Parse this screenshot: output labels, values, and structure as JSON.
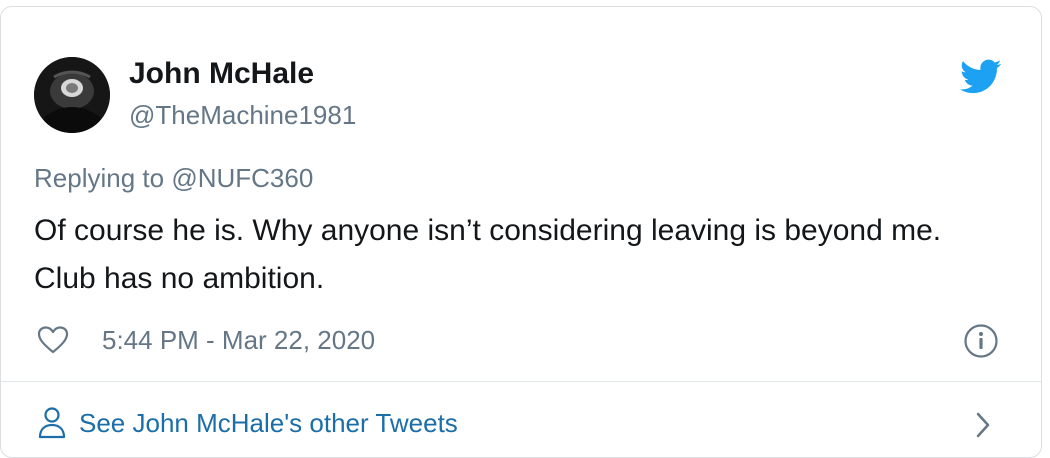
{
  "author": {
    "display_name": "John McHale",
    "handle": "@TheMachine1981",
    "avatar_icon": "profile-photo"
  },
  "tweet": {
    "reply_prefix": "Replying to ",
    "reply_to": "@NUFC360",
    "text": "Of course he is. Why anyone isn’t considering leaving is beyond me. Club has no ambition.",
    "timestamp": "5:44 PM - Mar 22, 2020"
  },
  "footer": {
    "link_label": "See John McHale's other Tweets"
  },
  "icons": {
    "brand": "twitter-bird-icon",
    "like": "heart-icon",
    "info": "info-icon",
    "person": "person-icon",
    "chevron": "chevron-right-icon"
  },
  "colors": {
    "brand": "#1da1f2",
    "text": "#14171a",
    "secondary": "#657786",
    "link": "#1b6ea8",
    "border": "#dcdfe2"
  }
}
